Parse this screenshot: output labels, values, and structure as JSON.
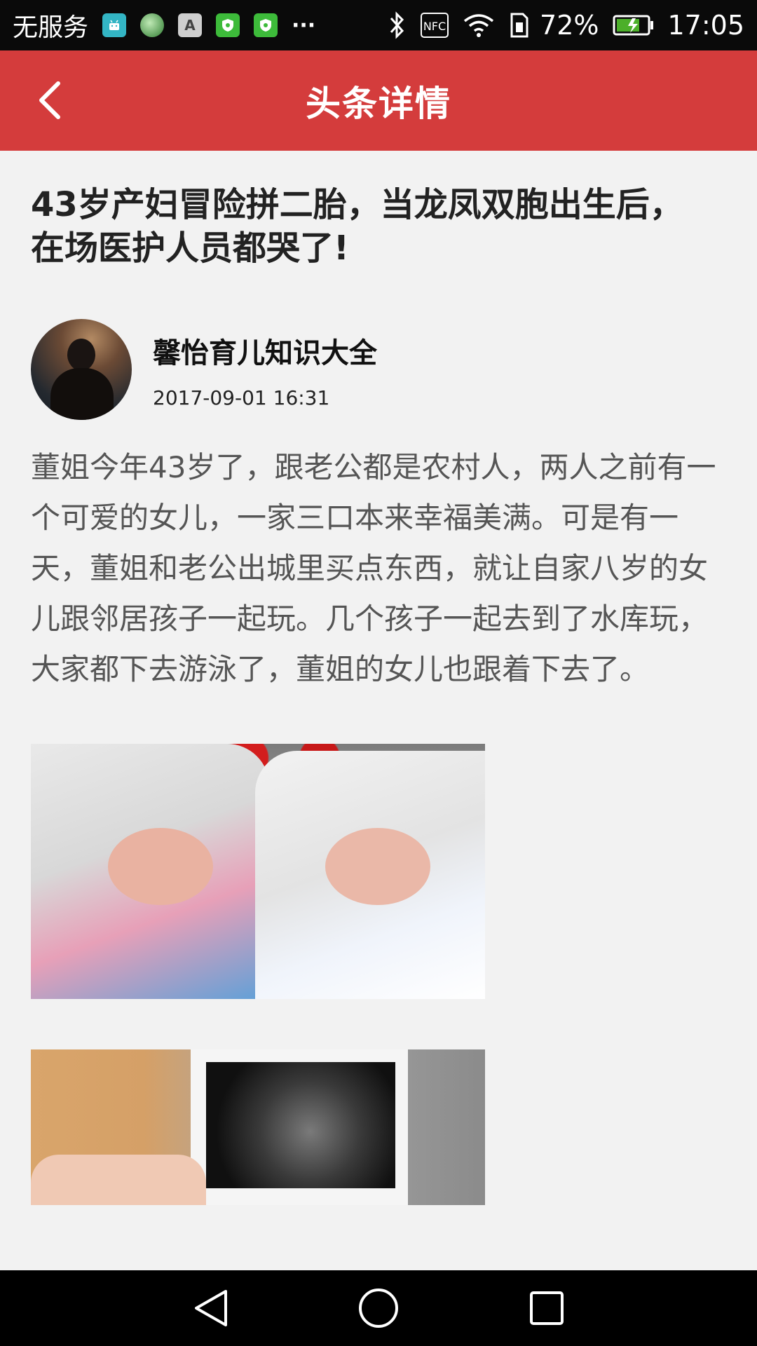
{
  "status_bar": {
    "carrier": "无服务",
    "notification_icons": [
      "android-icon",
      "globe-icon",
      "a-icon",
      "shield-icon",
      "shield-icon"
    ],
    "more": "···",
    "battery_percent": "72%",
    "time": "17:05",
    "nfc_label": "NFC"
  },
  "header": {
    "title": "头条详情"
  },
  "article": {
    "title": "43岁产妇冒险拼二胎，当龙凤双胞出生后，在场医护人员都哭了!",
    "author": "馨怡育儿知识大全",
    "published": "2017-09-01 16:31",
    "body": "董姐今年43岁了，跟老公都是农村人，两人之前有一个可爱的女儿，一家三口本来幸福美满。可是有一天，董姐和老公出城里买点东西，就让自家八岁的女儿跟邻居孩子一起玩。几个孩子一起去到了水库玩，大家都下去游泳了，董姐的女儿也跟着下去了。"
  },
  "colors": {
    "header_bg": "#d43c3c",
    "page_bg": "#f2f2f2",
    "title_text": "#222222",
    "body_text": "#555555"
  }
}
